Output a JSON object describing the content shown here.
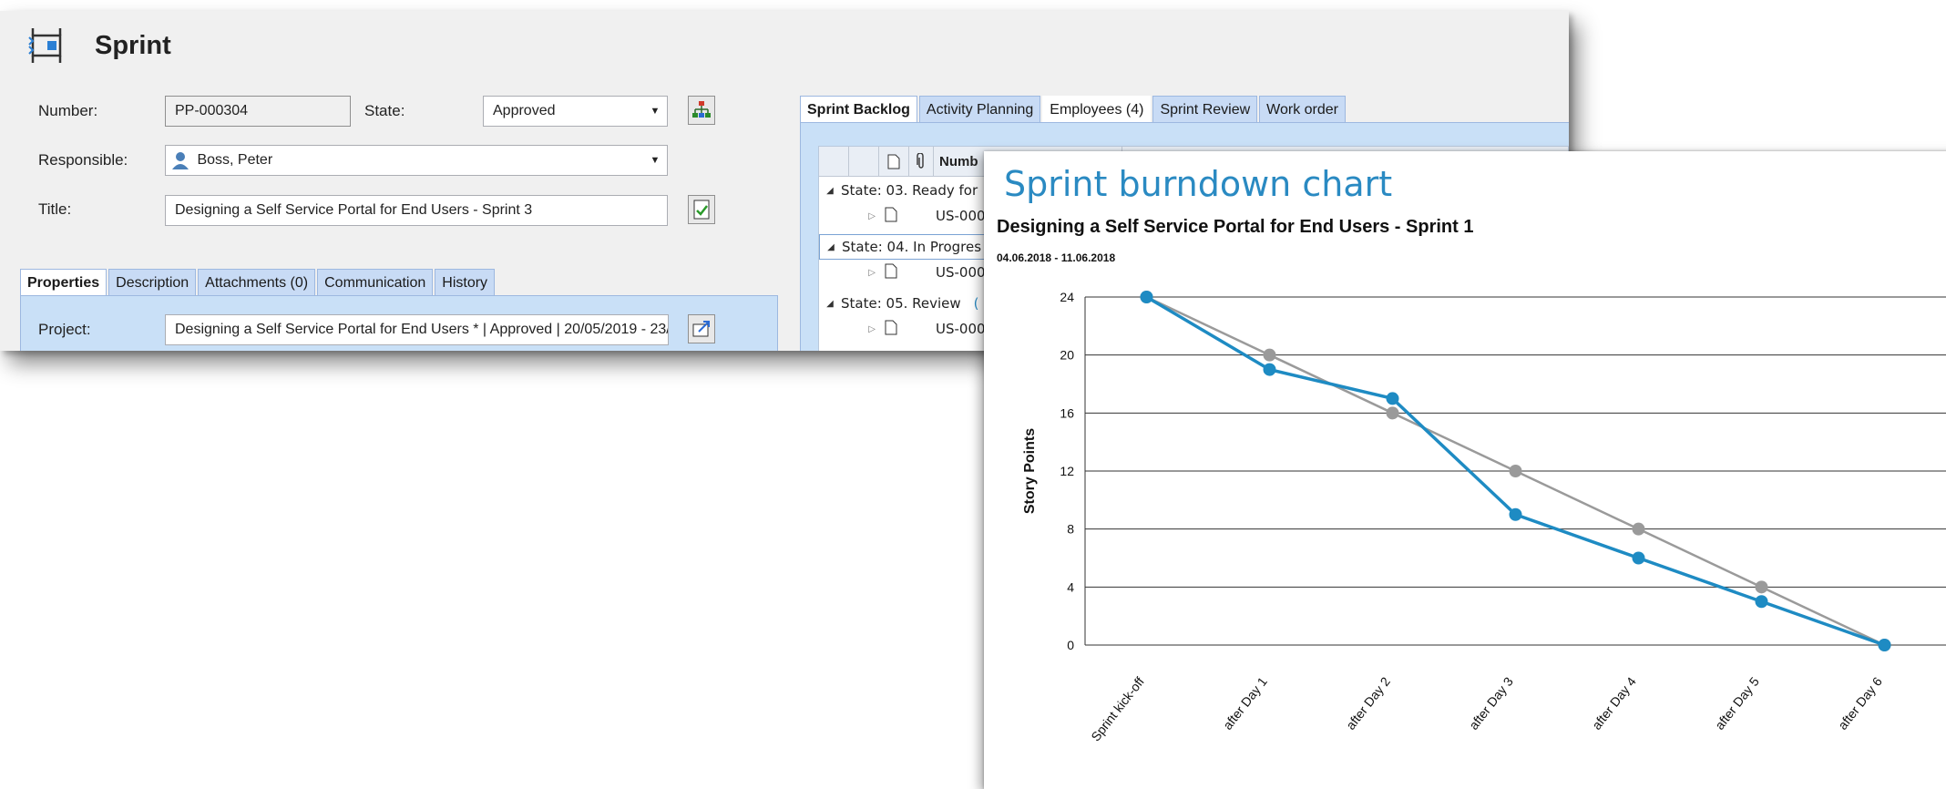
{
  "form": {
    "title": "Sprint",
    "icon": "sprint-icon",
    "fields": {
      "number_label": "Number:",
      "number_value": "PP-000304",
      "state_label": "State:",
      "state_value": "Approved",
      "responsible_label": "Responsible:",
      "responsible_value": "Boss, Peter",
      "title_label": "Title:",
      "title_value": "Designing a Self Service Portal for End Users - Sprint 3",
      "project_label": "Project:",
      "project_value": "Designing a Self Service Portal for End Users * | Approved | 20/05/2019 - 23/"
    },
    "left_tabs": [
      "Properties",
      "Description",
      "Attachments (0)",
      "Communication",
      "History"
    ],
    "right_tabs": [
      "Sprint Backlog",
      "Activity Planning",
      "Employees (4)",
      "Sprint Review",
      "Work order"
    ],
    "grid": {
      "header_number": "Numb",
      "rows": [
        {
          "type": "group",
          "text": "State: 03. Ready for"
        },
        {
          "type": "child",
          "text": "US-000"
        },
        {
          "type": "group",
          "text": "State: 04. In Progres"
        },
        {
          "type": "child",
          "text": "US-000"
        },
        {
          "type": "group",
          "text": "State: 05. Review",
          "suffix": "("
        },
        {
          "type": "child",
          "text": "US-000"
        }
      ]
    },
    "colors": {
      "tab_bg": "#c8dbf5",
      "panel_bg": "#c9e0f7"
    }
  },
  "chart_window": {
    "heading": "Sprint burndown chart"
  },
  "chart_data": {
    "type": "line",
    "title": "Designing a Self Service Portal for End Users - Sprint 1",
    "subtitle": "04.06.2018 - 11.06.2018",
    "xlabel": "",
    "ylabel": "Story Points",
    "categories": [
      "Sprint kick-off",
      "after Day 1",
      "after Day 2",
      "after Day 3",
      "after Day 4",
      "after Day 5",
      "after Day 6"
    ],
    "ylim": [
      0,
      24
    ],
    "yticks": [
      0,
      4,
      8,
      12,
      16,
      20,
      24
    ],
    "grid": true,
    "series": [
      {
        "color": "#9a9a9a",
        "values": [
          24,
          20,
          16,
          12,
          8,
          4,
          0
        ]
      },
      {
        "color": "#1e8bc3",
        "values": [
          24,
          19,
          17,
          9,
          6,
          3,
          0
        ]
      }
    ]
  }
}
